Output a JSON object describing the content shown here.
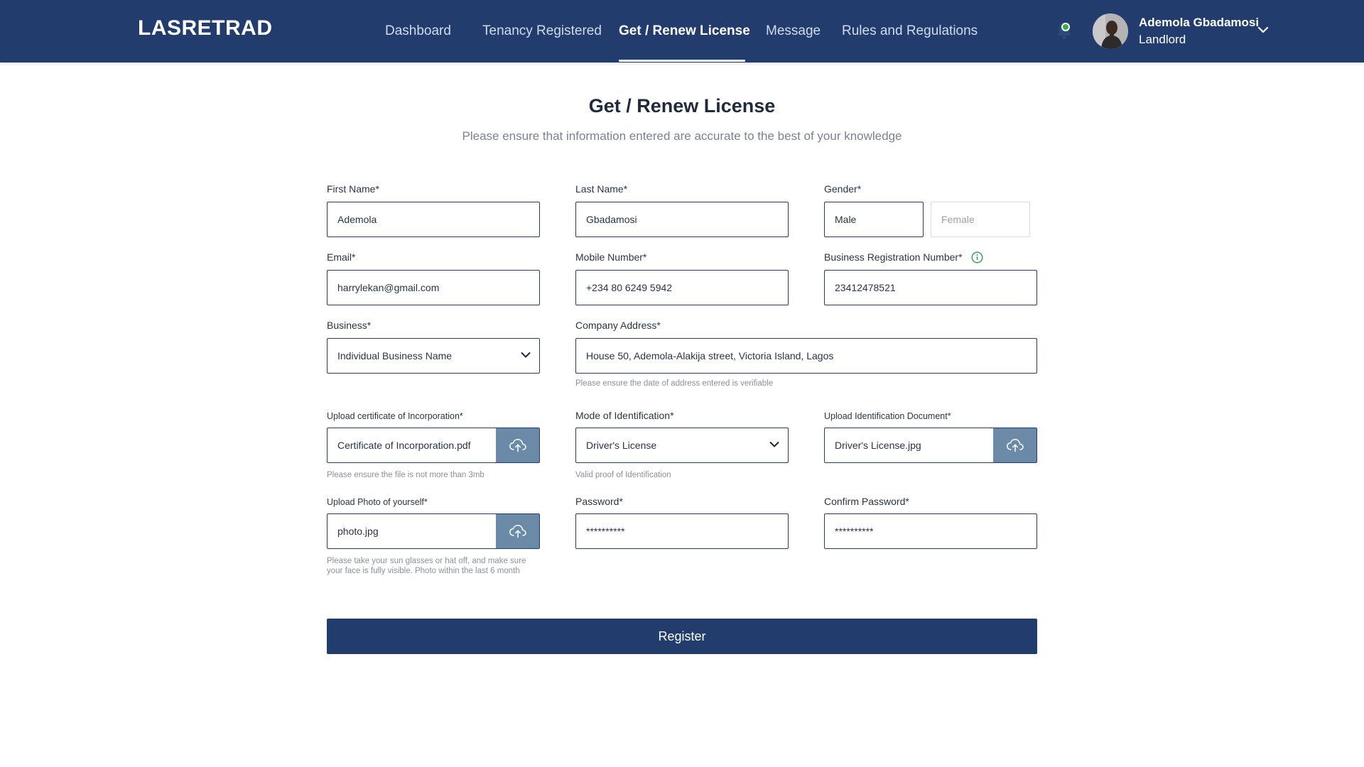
{
  "header": {
    "brand": "LASRETRAD",
    "nav": [
      {
        "label": "Dashboard",
        "active": false
      },
      {
        "label": "Tenancy Registered",
        "active": false
      },
      {
        "label": "Get / Renew License",
        "active": true
      },
      {
        "label": "Message",
        "active": false
      },
      {
        "label": "Rules and Regulations",
        "active": false
      }
    ],
    "user": {
      "name": "Ademola Gbadamosi",
      "role": "Landlord"
    },
    "notification_status_color": "#2fb24b",
    "colors": {
      "primary": "#223d6d",
      "upload_button": "#6a8aa8"
    }
  },
  "page": {
    "title": "Get / Renew License",
    "subtitle": "Please ensure that information entered are accurate to the best of your knowledge"
  },
  "form": {
    "first_name": {
      "label": "First Name*",
      "value": "Ademola"
    },
    "last_name": {
      "label": "Last Name*",
      "value": "Gbadamosi"
    },
    "gender": {
      "label": "Gender*",
      "options": [
        "Male",
        "Female"
      ],
      "selected": "Male"
    },
    "email": {
      "label": "Email*",
      "value": "harrylekan@gmail.com"
    },
    "mobile": {
      "label": "Mobile Number*",
      "value": "+234 80 6249 5942"
    },
    "brn": {
      "label": "Business Registration Number*",
      "value": "23412478521",
      "icon": "info-icon"
    },
    "business": {
      "label": "Business*",
      "value": "Individual Business Name"
    },
    "company_address": {
      "label": "Company Address*",
      "value": "House 50, Ademola-Alakija street, Victoria Island, Lagos",
      "hint": "Please ensure the date of address entered is verifiable"
    },
    "certificate": {
      "label": "Upload certificate of Incorporation*",
      "value": "Certificate of Incorporation.pdf",
      "hint": "Please ensure the file is not more than 3mb",
      "icon": "cloud-upload-icon"
    },
    "mode_of_id": {
      "label": "Mode of Identification*",
      "value": "Driver's License",
      "hint": "Valid proof of Identification"
    },
    "id_document": {
      "label": "Upload Identification Document*",
      "value": "Driver's License.jpg",
      "icon": "cloud-upload-icon"
    },
    "photo": {
      "label": "Upload Photo of yourself*",
      "value": "photo.jpg",
      "hint_line1": "Please take your sun glasses or hat off, and make sure",
      "hint_line2": "your face is fully visible. Photo within the last 6 month",
      "icon": "cloud-upload-icon"
    },
    "password": {
      "label": "Password*",
      "value": "**********"
    },
    "confirm_password": {
      "label": "Confirm Password*",
      "value": "**********"
    },
    "submit_label": "Register"
  }
}
